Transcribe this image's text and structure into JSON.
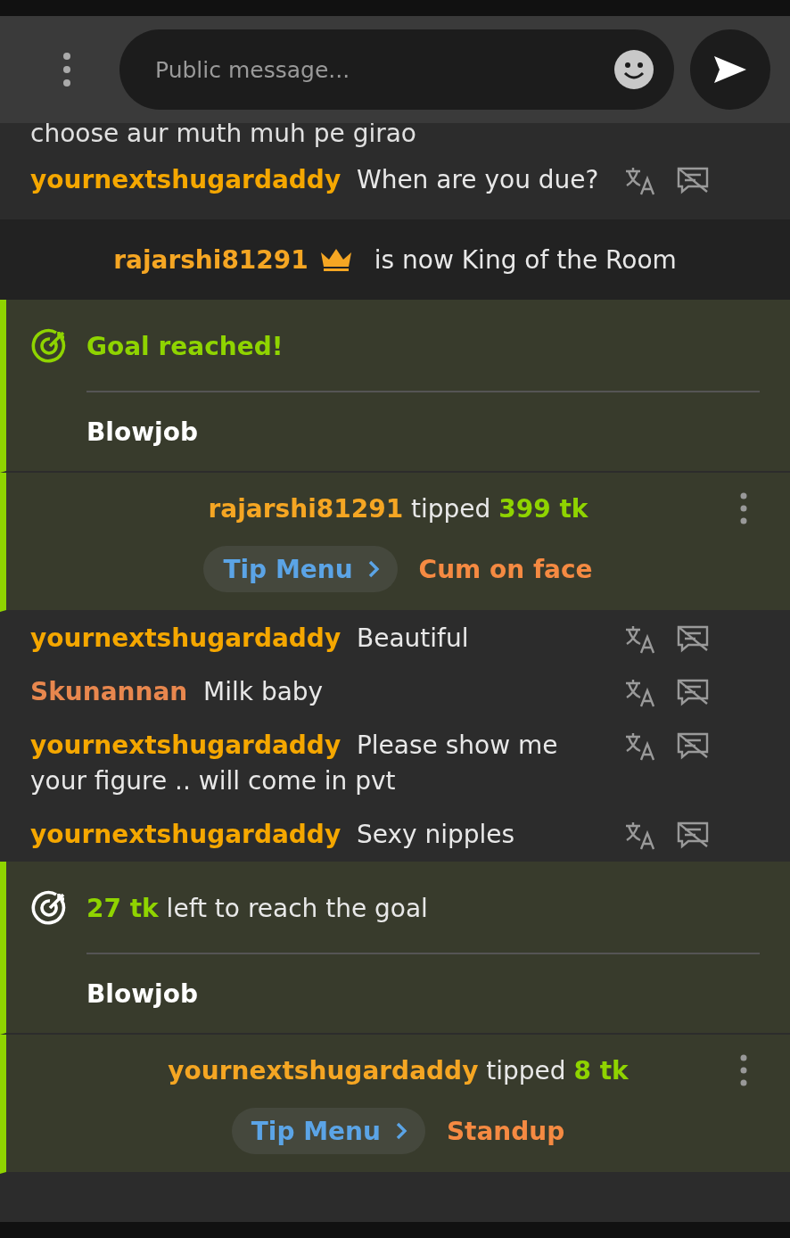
{
  "input": {
    "placeholder": "Public message..."
  },
  "messages": [
    {
      "kind": "continuation",
      "text": "choose aur muth muh pe girao"
    },
    {
      "kind": "chat",
      "user": "yournextshugardaddy",
      "color": "#f5a700",
      "text": "When are you due?"
    },
    {
      "kind": "king",
      "user": "rajarshi81291",
      "text": "is now King of the Room"
    },
    {
      "kind": "goal_reached",
      "title": "Goal reached!",
      "goal": "Blowjob"
    },
    {
      "kind": "tip",
      "user": "rajarshi81291",
      "verb": "tipped",
      "amount": "399 tk",
      "menu": "Tip Menu",
      "item": "Cum on face"
    },
    {
      "kind": "chat",
      "user": "yournextshugardaddy",
      "color": "#f5a700",
      "text": "Beautiful"
    },
    {
      "kind": "chat",
      "user": "Skunannan",
      "color": "#e8874e",
      "text": "Milk baby"
    },
    {
      "kind": "chat",
      "user": "yournextshugardaddy",
      "color": "#f5a700",
      "text": "Please show me your figure .. will come in pvt"
    },
    {
      "kind": "chat",
      "user": "yournextshugardaddy",
      "color": "#f5a700",
      "text": "Sexy nipples"
    },
    {
      "kind": "goal_progress",
      "amount": "27 tk",
      "text": "left to reach the goal",
      "goal": "Blowjob"
    },
    {
      "kind": "tip",
      "user": "yournextshugardaddy",
      "verb": "tipped",
      "amount": "8 tk",
      "menu": "Tip Menu",
      "item": "Standup"
    }
  ]
}
